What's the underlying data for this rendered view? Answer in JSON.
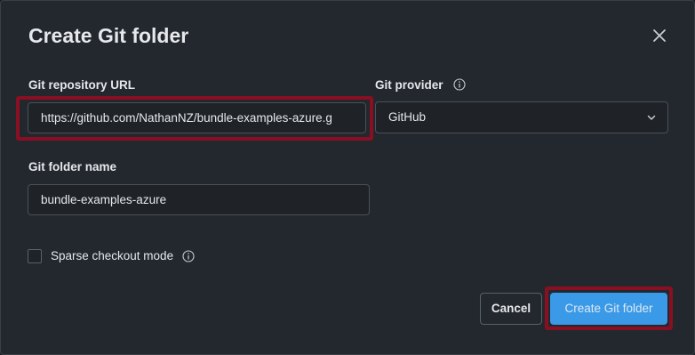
{
  "dialog": {
    "title": "Create Git folder",
    "close_icon": "close-icon"
  },
  "repo_url": {
    "label": "Git repository URL",
    "value": "https://github.com/NathanNZ/bundle-examples-azure.g"
  },
  "provider": {
    "label": "Git provider",
    "info_icon": "info-icon",
    "selected": "GitHub",
    "chevron_icon": "chevron-down-icon"
  },
  "folder_name": {
    "label": "Git folder name",
    "value": "bundle-examples-azure"
  },
  "sparse_checkout": {
    "label": "Sparse checkout mode",
    "checked": false,
    "info_icon": "info-icon"
  },
  "buttons": {
    "cancel": "Cancel",
    "create": "Create Git folder"
  },
  "colors": {
    "highlight": "#8a0f22",
    "primary": "#3b9ae8"
  }
}
